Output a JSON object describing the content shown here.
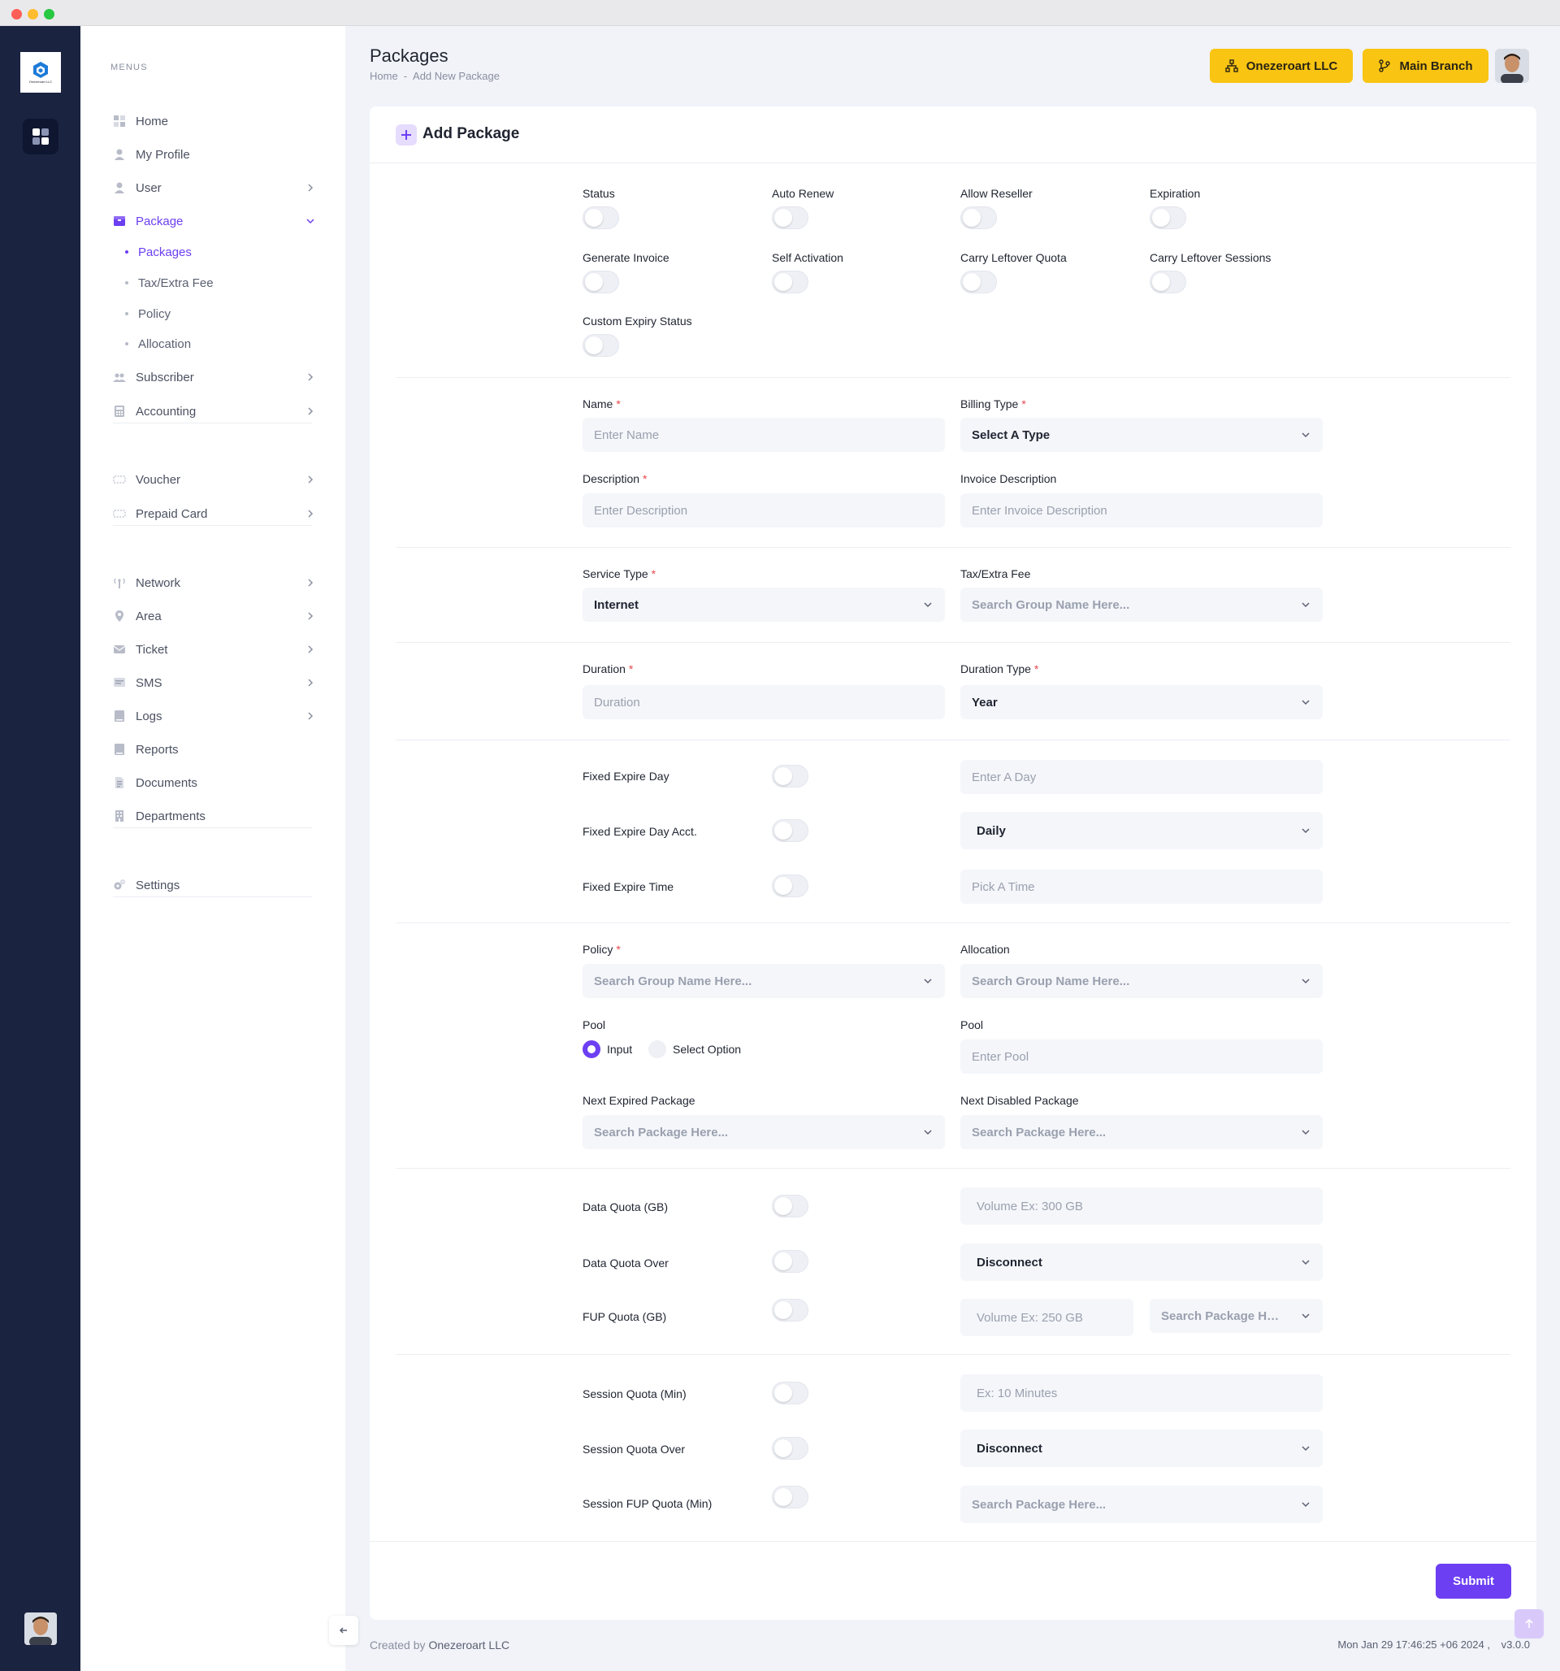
{
  "sidebar": {
    "menus_label": "MENUS",
    "items": [
      {
        "label": "Home",
        "icon": "home-icon"
      },
      {
        "label": "My Profile",
        "icon": "profile-icon"
      },
      {
        "label": "User",
        "icon": "user-icon"
      },
      {
        "label": "Package",
        "icon": "package-icon"
      },
      {
        "label": "Subscriber",
        "icon": "subscriber-icon"
      },
      {
        "label": "Accounting",
        "icon": "accounting-icon"
      },
      {
        "label": "Voucher",
        "icon": "voucher-icon"
      },
      {
        "label": "Prepaid Card",
        "icon": "prepaid-card-icon"
      },
      {
        "label": "Network",
        "icon": "network-icon"
      },
      {
        "label": "Area",
        "icon": "area-icon"
      },
      {
        "label": "Ticket",
        "icon": "ticket-icon"
      },
      {
        "label": "SMS",
        "icon": "sms-icon"
      },
      {
        "label": "Logs",
        "icon": "logs-icon"
      },
      {
        "label": "Reports",
        "icon": "reports-icon"
      },
      {
        "label": "Documents",
        "icon": "documents-icon"
      },
      {
        "label": "Departments",
        "icon": "departments-icon"
      },
      {
        "label": "Settings",
        "icon": "settings-icon"
      }
    ],
    "package_sub": [
      "Packages",
      "Tax/Extra Fee",
      "Policy",
      "Allocation"
    ]
  },
  "header": {
    "title": "Packages",
    "breadcrumb_home": "Home",
    "breadcrumb_sep": "-",
    "breadcrumb_current": "Add New Package",
    "company_button": "Onezeroart LLC",
    "branch_button": "Main Branch"
  },
  "form": {
    "title": "Add Package",
    "toggles": {
      "status": "Status",
      "auto_renew": "Auto Renew",
      "allow_reseller": "Allow Reseller",
      "expiration": "Expiration",
      "generate_invoice": "Generate Invoice",
      "self_activation": "Self Activation",
      "carry_leftover_quota": "Carry Leftover Quota",
      "carry_leftover_sessions": "Carry Leftover Sessions",
      "custom_expiry_status": "Custom Expiry Status"
    },
    "name": {
      "label": "Name",
      "placeholder": "Enter Name"
    },
    "billing_type": {
      "label": "Billing Type",
      "value": "Select A Type"
    },
    "description": {
      "label": "Description",
      "placeholder": "Enter Description"
    },
    "invoice_description": {
      "label": "Invoice Description",
      "placeholder": "Enter Invoice Description"
    },
    "service_type": {
      "label": "Service Type",
      "value": "Internet"
    },
    "tax_fee": {
      "label": "Tax/Extra Fee",
      "placeholder": "Search Group Name Here..."
    },
    "duration": {
      "label": "Duration",
      "placeholder": "Duration"
    },
    "duration_type": {
      "label": "Duration Type",
      "value": "Year"
    },
    "fixed_expire_day": {
      "label": "Fixed Expire Day",
      "placeholder": "Enter A Day"
    },
    "fixed_expire_day_acct": {
      "label": "Fixed Expire Day Acct.",
      "value": "Daily"
    },
    "fixed_expire_time": {
      "label": "Fixed Expire Time",
      "placeholder": "Pick A Time"
    },
    "policy": {
      "label": "Policy",
      "placeholder": "Search Group Name Here..."
    },
    "allocation": {
      "label": "Allocation",
      "placeholder": "Search Group Name Here..."
    },
    "pool": {
      "label": "Pool",
      "option_input": "Input",
      "option_select": "Select Option"
    },
    "pool_input": {
      "label": "Pool",
      "placeholder": "Enter Pool"
    },
    "next_expired": {
      "label": "Next Expired Package",
      "placeholder": "Search Package Here..."
    },
    "next_disabled": {
      "label": "Next Disabled Package",
      "placeholder": "Search Package Here..."
    },
    "data_quota": {
      "label": "Data Quota (GB)",
      "placeholder": "Volume Ex: 300 GB"
    },
    "data_quota_over": {
      "label": "Data Quota Over",
      "value": "Disconnect"
    },
    "fup_quota": {
      "label": "FUP Quota (GB)",
      "placeholder": "Volume Ex: 250 GB",
      "package_placeholder": "Search Package Her..."
    },
    "session_quota": {
      "label": "Session Quota (Min)",
      "placeholder": "Ex: 10 Minutes"
    },
    "session_quota_over": {
      "label": "Session Quota Over",
      "value": "Disconnect"
    },
    "session_fup_quota": {
      "label": "Session FUP Quota (Min)",
      "placeholder": "Search Package Here..."
    },
    "required_mark": "*",
    "submit": "Submit"
  },
  "footer": {
    "created_by": "Created by",
    "company": "Onezeroart LLC",
    "timestamp": "Mon Jan 29 17:46:25 +06 2024 ,",
    "version": "v3.0.0"
  },
  "colors": {
    "accent": "#6c3ff2",
    "highlight": "#f9c412",
    "rail": "#1a2340"
  }
}
